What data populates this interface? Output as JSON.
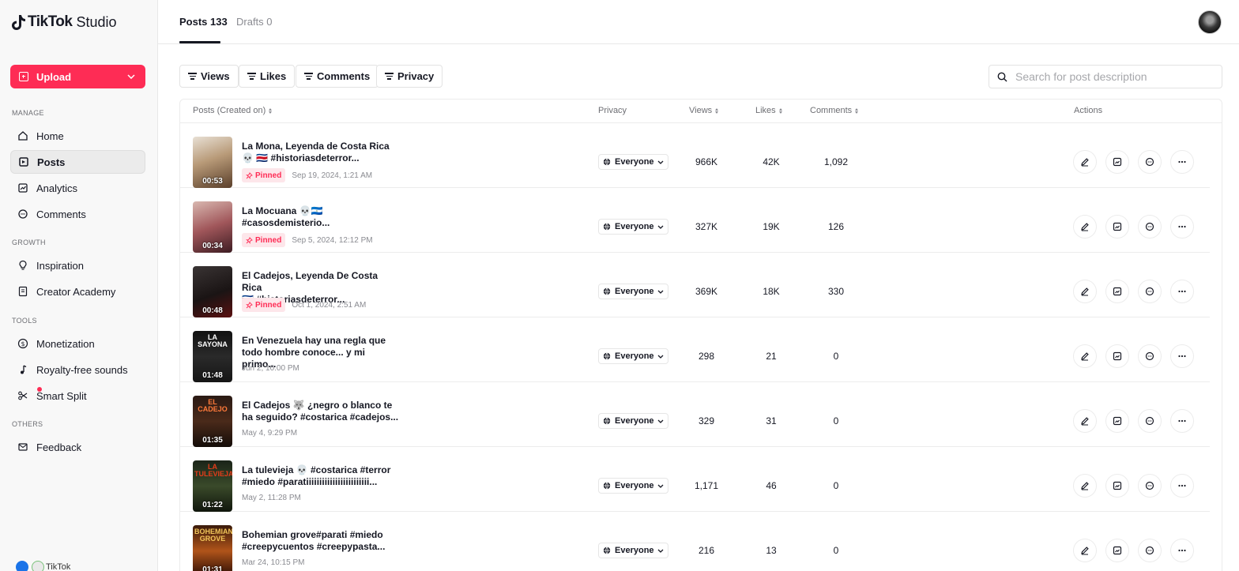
{
  "app": {
    "logo": "TikTok",
    "logo_sub": "Studio"
  },
  "sidebar": {
    "upload_label": "Upload",
    "sections": {
      "manage": "MANAGE",
      "growth": "GROWTH",
      "tools": "TOOLS",
      "others": "OTHERS"
    },
    "items": {
      "home": "Home",
      "posts": "Posts",
      "analytics": "Analytics",
      "comments": "Comments",
      "inspiration": "Inspiration",
      "creator_academy": "Creator Academy",
      "monetization": "Monetization",
      "royalty_free": "Royalty-free sounds",
      "smart_split": "Smart Split",
      "feedback": "Feedback"
    },
    "bottom_label": "TikTok",
    "active": "posts"
  },
  "tabs": {
    "posts": "Posts 133",
    "drafts": "Drafts 0"
  },
  "filters": {
    "views": "Views",
    "likes": "Likes",
    "comments": "Comments",
    "privacy": "Privacy"
  },
  "search": {
    "placeholder": "Search for post description",
    "value": ""
  },
  "table": {
    "headers": {
      "posts": "Posts (Created on)",
      "privacy": "Privacy",
      "views": "Views",
      "likes": "Likes",
      "comments": "Comments",
      "actions": "Actions"
    },
    "rows": [
      {
        "title_line1": "La Mona, Leyenda de Costa Rica",
        "title_line2": "💀 🇨🇷 #historiasdeterror...",
        "pinned": "Pinned",
        "date": "Sep 19, 2024, 1:21 AM",
        "duration": "00:53",
        "privacy": "Everyone",
        "views": "966K",
        "likes": "42K",
        "comments": "1,092",
        "thumb_text": ""
      },
      {
        "title_line1": "La Mocuana 💀🇳🇮",
        "title_line2": "#casosdemisterio...",
        "pinned": "Pinned",
        "date": "Sep 5, 2024, 12:12 PM",
        "duration": "00:34",
        "privacy": "Everyone",
        "views": "327K",
        "likes": "19K",
        "comments": "126",
        "thumb_text": ""
      },
      {
        "title_line1": "El Cadejos, Leyenda De Costa Rica",
        "title_line2": "🇨🇷 #historiasdeterror...",
        "pinned": "Pinned",
        "date": "Oct 1, 2024, 2:51 AM",
        "duration": "00:48",
        "privacy": "Everyone",
        "views": "369K",
        "likes": "18K",
        "comments": "330",
        "thumb_text": ""
      },
      {
        "title_line1": "En Venezuela hay una regla que",
        "title_line2": "todo hombre conoce... y mi primo...",
        "pinned": "",
        "date": "Jun 2, 10:00 PM",
        "duration": "01:48",
        "privacy": "Everyone",
        "views": "298",
        "likes": "21",
        "comments": "0",
        "thumb_text": "LA SAYONA"
      },
      {
        "title_line1": "El Cadejos 🐺 ¿negro o blanco te",
        "title_line2": "ha seguido? #costarica #cadejos...",
        "pinned": "",
        "date": "May 4, 9:29 PM",
        "duration": "01:35",
        "privacy": "Everyone",
        "views": "329",
        "likes": "31",
        "comments": "0",
        "thumb_text": "EL CADEJO"
      },
      {
        "title_line1": "La tulevieja 💀 #costarica #terror",
        "title_line2": "#miedo #paratiiiiiiiiiiiiiiiiiiiiiiii...",
        "pinned": "",
        "date": "May 2, 11:28 PM",
        "duration": "01:22",
        "privacy": "Everyone",
        "views": "1,171",
        "likes": "46",
        "comments": "0",
        "thumb_text": "LA TULEVIEJA"
      },
      {
        "title_line1": "Bohemian grove#parati #miedo",
        "title_line2": "#creepycuentos #creepypasta...",
        "pinned": "",
        "date": "Mar 24, 10:15 PM",
        "duration": "01:31",
        "privacy": "Everyone",
        "views": "216",
        "likes": "13",
        "comments": "0",
        "thumb_text": "BOHEMIAN GROVE"
      }
    ]
  },
  "colors": {
    "accent": "#fe2c55",
    "text": "#161823",
    "muted": "#8a8b91"
  }
}
